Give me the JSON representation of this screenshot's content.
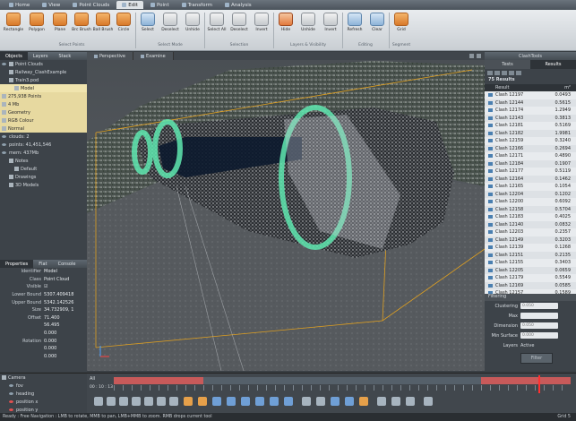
{
  "menu_tabs": [
    {
      "label": "Home",
      "active": false
    },
    {
      "label": "View",
      "active": false
    },
    {
      "label": "Point Clouds",
      "active": false
    },
    {
      "label": "Edit",
      "active": true
    },
    {
      "label": "Point",
      "active": false
    },
    {
      "label": "Transform",
      "active": false
    },
    {
      "label": "Analysis",
      "active": false
    }
  ],
  "ribbon": {
    "buttons": [
      "Rectangle",
      "Polygon",
      "Plane",
      "Brc Brush",
      "Ball Brush",
      "Circle",
      "Select",
      "Deselect",
      "Unhide",
      "Select All",
      "Deselect",
      "Invert",
      "Hide",
      "Unhide",
      "Invert",
      "Refresh",
      "Clear",
      "Grid"
    ],
    "groups": [
      "Select Points",
      "Select Mode",
      "Selection",
      "Layers & Visibility",
      "Editing",
      "Segment"
    ]
  },
  "objects_panel": {
    "tabs": [
      "Objects",
      "Layers",
      "Stack"
    ],
    "tree": [
      {
        "label": "Point Clouds",
        "indent": 0
      },
      {
        "label": "Railway_ClashExample",
        "indent": 1
      },
      {
        "label": "Train3.pod",
        "indent": 1
      },
      {
        "label": "Model",
        "indent": 2
      },
      {
        "label": "275,938 Points",
        "indent": 0
      },
      {
        "label": "4 Mb",
        "indent": 0
      },
      {
        "label": "Geometry",
        "indent": 0
      },
      {
        "label": "RGB Colour",
        "indent": 0
      },
      {
        "label": "Normal",
        "indent": 0
      },
      {
        "label": "clouds: 2",
        "indent": 0
      },
      {
        "label": "points: 41,451,546",
        "indent": 0
      },
      {
        "label": "mem: 437Mb",
        "indent": 0
      },
      {
        "label": "Notes",
        "indent": 1
      },
      {
        "label": "Default",
        "indent": 2
      },
      {
        "label": "Drawings",
        "indent": 1
      },
      {
        "label": "3D Models",
        "indent": 1
      }
    ]
  },
  "properties_panel": {
    "tabs": [
      "Properties",
      "Flat",
      "Console"
    ],
    "rows": [
      {
        "key": "Identifier",
        "value": "Model"
      },
      {
        "key": "Class",
        "value": "Point Cloud"
      },
      {
        "key": "Visible",
        "value": "☑"
      },
      {
        "key": "Lower Bound",
        "value": "5307.409418"
      },
      {
        "key": "Upper Bound",
        "value": "5342.142526"
      },
      {
        "key": "Size",
        "value": "34.732909, 1"
      },
      {
        "key": "Offset",
        "value": "71.400"
      },
      {
        "key": "",
        "value": "56.495"
      },
      {
        "key": "",
        "value": "0.000"
      },
      {
        "key": "Rotation",
        "value": "0.000"
      },
      {
        "key": "",
        "value": "0.000"
      },
      {
        "key": "",
        "value": "0.000"
      }
    ]
  },
  "camera_panel": {
    "title": "Camera",
    "rows": [
      "fov",
      "heading",
      "position x",
      "position y"
    ]
  },
  "viewport": {
    "tabs": [
      "Perspective",
      "Examine"
    ]
  },
  "clash_panel": {
    "title": "ClashTools",
    "tabs": [
      "Tests",
      "Results"
    ],
    "count_label": "75 Results",
    "col_result": "Result",
    "col_unit": "m²",
    "results": [
      {
        "name": "Clash 12197",
        "value": "0.0493"
      },
      {
        "name": "Clash 12144",
        "value": "0.5615"
      },
      {
        "name": "Clash 12174",
        "value": "1.2949"
      },
      {
        "name": "Clash 12143",
        "value": "0.3813"
      },
      {
        "name": "Clash 12181",
        "value": "0.5169"
      },
      {
        "name": "Clash 12182",
        "value": "1.9981"
      },
      {
        "name": "Clash 12159",
        "value": "0.3240"
      },
      {
        "name": "Clash 12166",
        "value": "0.2694"
      },
      {
        "name": "Clash 12171",
        "value": "0.4890"
      },
      {
        "name": "Clash 12184",
        "value": "0.1907"
      },
      {
        "name": "Clash 12177",
        "value": "0.5119"
      },
      {
        "name": "Clash 12164",
        "value": "0.1462"
      },
      {
        "name": "Clash 12165",
        "value": "0.1054"
      },
      {
        "name": "Clash 12204",
        "value": "0.1202"
      },
      {
        "name": "Clash 12200",
        "value": "0.6092"
      },
      {
        "name": "Clash 12158",
        "value": "0.5704"
      },
      {
        "name": "Clash 12183",
        "value": "0.4025"
      },
      {
        "name": "Clash 12140",
        "value": "0.0832"
      },
      {
        "name": "Clash 12203",
        "value": "0.2357"
      },
      {
        "name": "Clash 12149",
        "value": "0.3203"
      },
      {
        "name": "Clash 12139",
        "value": "0.1268"
      },
      {
        "name": "Clash 12151",
        "value": "0.2135"
      },
      {
        "name": "Clash 12155",
        "value": "0.3403"
      },
      {
        "name": "Clash 12205",
        "value": "0.0659"
      },
      {
        "name": "Clash 12179",
        "value": "0.5549"
      },
      {
        "name": "Clash 12169",
        "value": "0.0585"
      },
      {
        "name": "Clash 12157",
        "value": "0.1589"
      }
    ],
    "filtering": {
      "title": "Filtering",
      "fields": [
        {
          "label": "Clustering",
          "value": "0.050"
        },
        {
          "label": "Max",
          "value": ""
        },
        {
          "label": "Dimension",
          "value": "0.050"
        },
        {
          "label": "Min Surface",
          "value": "0.000"
        }
      ],
      "layers_label": "Layers",
      "layers_value": "Active",
      "filter_button": "Filter"
    }
  },
  "timeline": {
    "label": "All",
    "time": "00 : 10 : 13"
  },
  "status_bar": {
    "text": "Ready : Free Navigation : LMB to rotate, MMB to pan, LMB+MMB to zoom. RMB drops current tool",
    "right": "Grid 5"
  },
  "colors": {
    "ribbon_icon": "#e0842f",
    "selected_tree": "#e7d9a0",
    "clash_ring": "#5fe8b0",
    "bounding_box": "#e0a020",
    "timeline_marker": "#ff3030"
  }
}
